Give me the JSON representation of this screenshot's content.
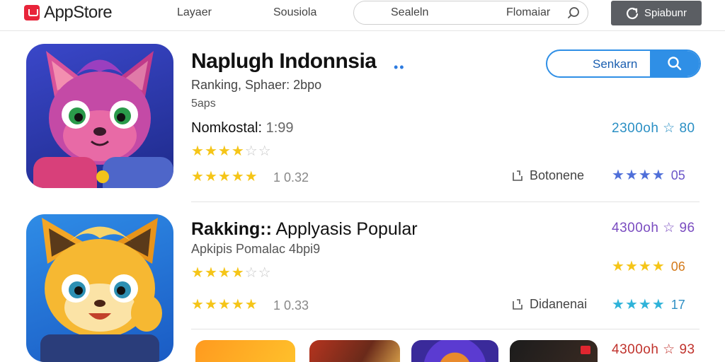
{
  "header": {
    "brand": "AppStore",
    "nav": [
      "Layaer",
      "Sousiola"
    ],
    "search_left": "Sealeln",
    "search_right": "Flomaiar",
    "signin_label": "Spiabunr"
  },
  "featured": {
    "title": "Naplugh Indonnsia",
    "subtitle": "Ranking, Sphaer: 2bpo",
    "meta": "5aps",
    "price_label": "Nomkostal:",
    "price_value": "1:99",
    "rating_value_1": "4",
    "rating_value_2": "5",
    "stars_value": "1 0.32",
    "search_label": "Senkarn",
    "right_rating": "2300oh ☆ 80",
    "developer": "Botonene",
    "right_stars_count": 4,
    "right_stars_value": "05"
  },
  "ranking": {
    "title_bold": "Rakking::",
    "title_rest": " Applyasis Popular",
    "subtitle": "Apkipis Pomalac 4bpi9",
    "rating_value_1": "4",
    "rating_value_2": "5",
    "stars_value": "1 0.33",
    "right_rating_1": "4300oh ☆ 96",
    "right_stars_value_2": "06",
    "developer": "Didanenai",
    "right_stars_value_3": "17",
    "right_rating_4": "4300oh ☆ 93"
  },
  "colors": {
    "accent": "#2f8fe6",
    "star": "#f5c518",
    "signin_bg": "#5b5e63"
  }
}
